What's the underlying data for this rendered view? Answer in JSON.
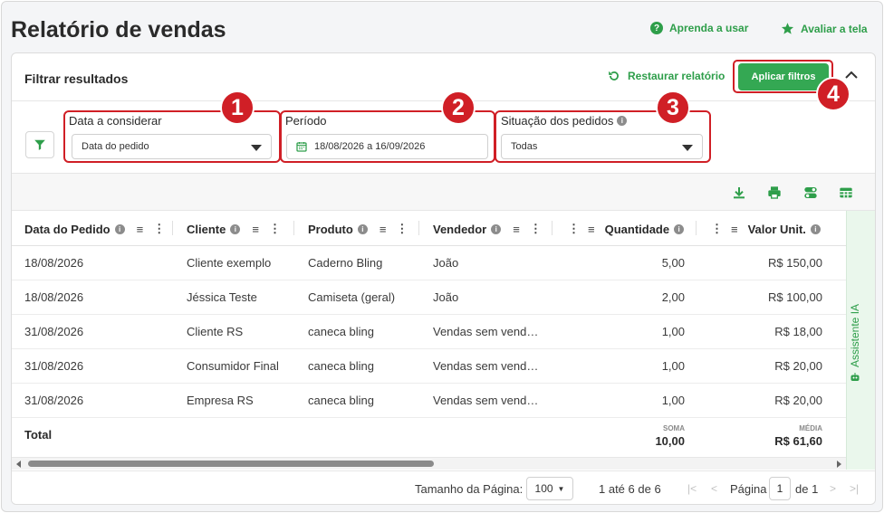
{
  "header": {
    "title": "Relatório de vendas",
    "help_link": "Aprenda a usar",
    "rate_link": "Avaliar a tela"
  },
  "filters": {
    "title": "Filtrar resultados",
    "restore_label": "Restaurar relatório",
    "apply_label": "Aplicar filtros",
    "date_field": {
      "label": "Data a considerar",
      "value": "Data do pedido"
    },
    "period_field": {
      "label": "Período",
      "value": "18/08/2026 a 16/09/2026"
    },
    "status_field": {
      "label": "Situação dos pedidos",
      "value": "Todas"
    }
  },
  "badges": [
    "1",
    "2",
    "3",
    "4"
  ],
  "table": {
    "columns": [
      "Data do Pedido",
      "Cliente",
      "Produto",
      "Vendedor",
      "Quantidade",
      "Valor Unit."
    ],
    "rows": [
      [
        "18/08/2026",
        "Cliente exemplo",
        "Caderno Bling",
        "João",
        "5,00",
        "R$ 150,00"
      ],
      [
        "18/08/2026",
        "Jéssica Teste",
        "Camiseta (geral)",
        "João",
        "2,00",
        "R$ 100,00"
      ],
      [
        "31/08/2026",
        "Cliente RS",
        "caneca bling",
        "Vendas sem vend…",
        "1,00",
        "R$ 18,00"
      ],
      [
        "31/08/2026",
        "Consumidor Final",
        "caneca bling",
        "Vendas sem vend…",
        "1,00",
        "R$ 20,00"
      ],
      [
        "31/08/2026",
        "Empresa RS",
        "caneca bling",
        "Vendas sem vend…",
        "1,00",
        "R$ 20,00"
      ]
    ],
    "total_label": "Total",
    "sum_label": "SOMA",
    "sum_value": "10,00",
    "avg_label": "MÉDIA",
    "avg_value": "R$ 61,60"
  },
  "side_panel": {
    "label": "Assistente IA"
  },
  "pagination": {
    "page_size_label": "Tamanho da Página:",
    "page_size": "100",
    "range": "1 até 6 de 6",
    "page_label": "Página",
    "page": "1",
    "of_label": "de 1"
  },
  "colors": {
    "accent": "#34a853",
    "highlight": "#d01f26"
  }
}
